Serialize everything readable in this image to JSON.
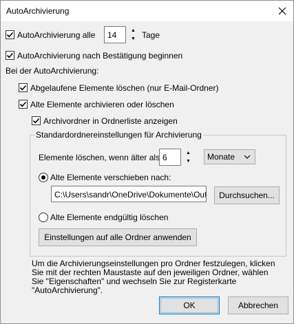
{
  "window": {
    "title": "AutoArchivierung"
  },
  "options": {
    "autoarchive_every_label": "AutoArchivierung alle",
    "autoarchive_days_value": "14",
    "days_unit": "Tage",
    "confirm_label": "AutoArchivierung nach Bestätigung beginnen",
    "section_heading": "Bei der AutoArchivierung:",
    "delete_expired_label": "Abgelaufene Elemente löschen (nur E-Mail-Ordner)",
    "archive_old_label": "Alte Elemente archivieren oder löschen",
    "show_folder_label": "Archivordner in Ordnerliste anzeigen"
  },
  "defaults_group": {
    "legend": "Standardordnereinstellungen für Archivierung",
    "clean_older_label": "Elemente löschen, wenn älter als",
    "clean_older_value": "6",
    "period_selected": "Monate",
    "move_old_label": "Alte Elemente verschieben nach:",
    "path_value": "C:\\Users\\sandr\\OneDrive\\Dokumente\\Outl",
    "browse_label": "Durchsuchen...",
    "delete_permanently_label": "Alte Elemente endgültig löschen",
    "apply_all_label": "Einstellungen auf alle Ordner anwenden"
  },
  "info_text": "Um die Archivierungseinstellungen pro Ordner festzulegen, klicken Sie mit der rechten Maustaste auf den jeweiligen Ordner, wählen Sie \"Eigenschaften\" und wechseln Sie zur Registerkarte \"AutoArchivierung\".",
  "footer": {
    "ok_label": "OK",
    "cancel_label": "Abbrechen"
  },
  "state": {
    "autoarchive_every": true,
    "confirm": true,
    "delete_expired": true,
    "archive_old": true,
    "show_folder": true,
    "radio_selected": "move"
  },
  "colors": {
    "accent": "#0078d7",
    "dialog_bg": "#f0f0f0"
  }
}
